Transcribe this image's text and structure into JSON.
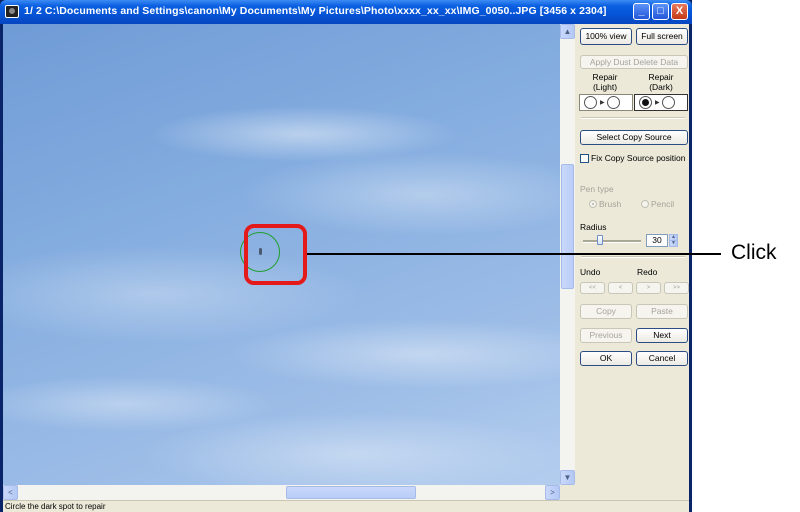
{
  "window": {
    "title": "1/  2  C:\\Documents and Settings\\canon\\My Documents\\My Pictures\\Photo\\xxxx_xx_xx\\IMG_0050..JPG [3456 x 2304]",
    "minimize_glyph": "_",
    "maximize_glyph": "□",
    "close_glyph": "X"
  },
  "panel": {
    "view_100_label": "100% view",
    "full_screen_label": "Full screen",
    "apply_dust_label": "Apply Dust Delete Data",
    "repair_light_label": "Repair\n(Light)",
    "repair_dark_label": "Repair\n(Dark)",
    "select_copy_source_label": "Select Copy Source",
    "fix_copy_source_label": "Fix Copy Source position",
    "pen_type_label": "Pen type",
    "brush_label": "Brush",
    "pencil_label": "Pencil",
    "radius_label": "Radius",
    "radius_value": "30",
    "undo_label": "Undo",
    "redo_label": "Redo",
    "undo_first_label": "<<",
    "undo_step_label": "<",
    "redo_step_label": ">",
    "redo_last_label": ">>",
    "copy_label": "Copy",
    "paste_label": "Paste",
    "previous_label": "Previous",
    "next_label": "Next",
    "ok_label": "OK",
    "cancel_label": "Cancel"
  },
  "scroll": {
    "up_glyph": "▲",
    "down_glyph": "▼",
    "left_glyph": "<",
    "right_glyph": ">"
  },
  "status": {
    "text": "Circle the dark spot to repair"
  },
  "annotation": {
    "label": "Click",
    "highlight_color": "#e41a1a"
  },
  "colors": {
    "titlebar": "#0553d6",
    "selection_circle": "#1fa02a"
  }
}
